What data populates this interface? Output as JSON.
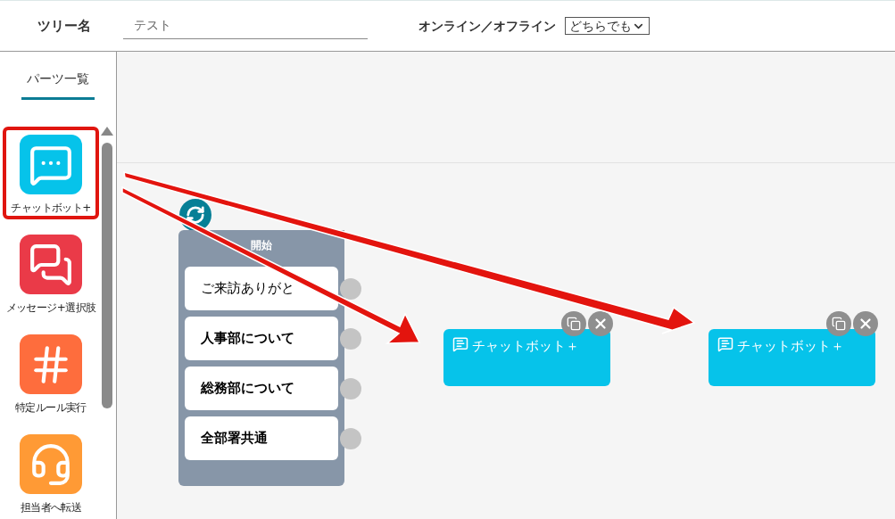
{
  "header": {
    "tree_name_label": "ツリー名",
    "tree_name_value": "テスト",
    "status_label": "オンライン／オフライン",
    "status_value": "どちらでも"
  },
  "sidebar": {
    "tab": {
      "label": "パーツ一覧",
      "selected": true
    },
    "items": [
      {
        "kind": "chatbot",
        "label": "チャットボット+",
        "color": "#06c3ea",
        "highlighted": true
      },
      {
        "kind": "message",
        "label": "メッセージ+選択肢",
        "color": "#ea3a48",
        "highlighted": false
      },
      {
        "kind": "rule",
        "label": "特定ルール実行",
        "color": "#fe6d3d",
        "highlighted": false
      },
      {
        "kind": "transfer",
        "label": "担当者へ転送",
        "color": "#ff9a35",
        "highlighted": false
      }
    ]
  },
  "canvas": {
    "start_node": {
      "title": "開始",
      "options": [
        {
          "label": "ご来訪ありがと",
          "bold": false
        },
        {
          "label": "人事部について",
          "bold": true
        },
        {
          "label": "総務部について",
          "bold": true
        },
        {
          "label": "全部署共通",
          "bold": true
        }
      ]
    },
    "nodes": [
      {
        "label": "チャットボット＋"
      },
      {
        "label": "チャットボット＋"
      }
    ]
  }
}
